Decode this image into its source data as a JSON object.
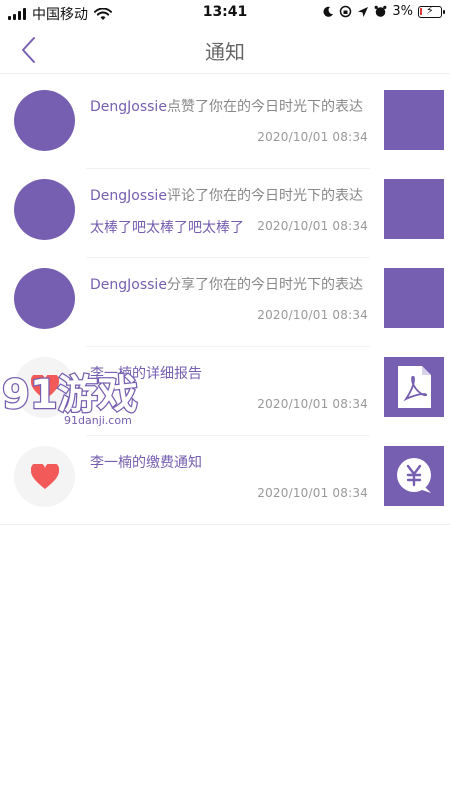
{
  "status_bar": {
    "carrier": "中国移动",
    "time": "13:41",
    "battery": "3%"
  },
  "nav": {
    "title": "通知"
  },
  "notifications": [
    {
      "name": "DengJossie",
      "action": "点赞了你在的今日时光下的表达",
      "comment": "",
      "time": "2020/10/01   08:34",
      "avatar": "purple-circle",
      "thumb_icon": ""
    },
    {
      "name": "DengJossie",
      "action": "评论了你在的今日时光下的表达",
      "comment": "太棒了吧太棒了吧太棒了",
      "time": "2020/10/01   08:34",
      "avatar": "purple-circle",
      "thumb_icon": ""
    },
    {
      "name": "DengJossie",
      "action": "分享了你在的今日时光下的表达",
      "comment": "",
      "time": "2020/10/01   08:34",
      "avatar": "purple-circle",
      "thumb_icon": ""
    },
    {
      "name": "",
      "action": "李一楠的详细报告",
      "comment": "",
      "time": "2020/10/01   08:34",
      "avatar": "heart-icon",
      "thumb_icon": "pdf-file-icon"
    },
    {
      "name": "",
      "action": "李一楠的缴费通知",
      "comment": "",
      "time": "2020/10/01   08:34",
      "avatar": "heart-icon",
      "thumb_icon": "yen-chat-icon"
    }
  ],
  "watermark": {
    "logo": "91游戏",
    "site": "91danji.com"
  },
  "colors": {
    "accent": "#765fb0",
    "heart": "#f25a5a",
    "muted": "#999999"
  }
}
